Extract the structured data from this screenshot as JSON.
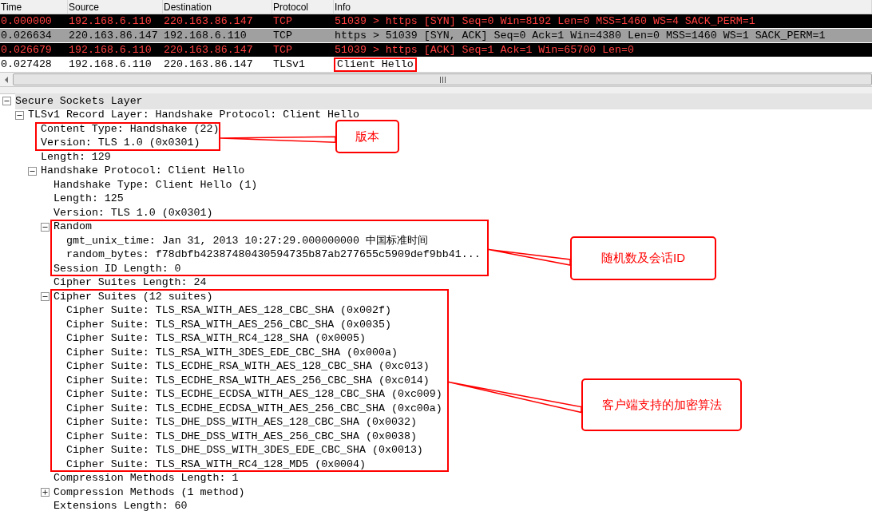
{
  "packet_list": {
    "columns": [
      "Time",
      "Source",
      "Destination",
      "Protocol",
      "Info"
    ],
    "rows": [
      {
        "kind": "dark",
        "cells": [
          "0.000000",
          "192.168.6.110",
          "220.163.86.147",
          "TCP",
          "51039 > https [SYN] Seq=0 Win=8192 Len=0 MSS=1460 WS=4 SACK_PERM=1"
        ],
        "info_boxed": false
      },
      {
        "kind": "gray",
        "cells": [
          "0.026634",
          "220.163.86.147",
          "192.168.6.110",
          "TCP",
          "https > 51039 [SYN, ACK] Seq=0 Ack=1 Win=4380 Len=0 MSS=1460 WS=1 SACK_PERM=1"
        ],
        "info_boxed": false
      },
      {
        "kind": "dark",
        "cells": [
          "0.026679",
          "192.168.6.110",
          "220.163.86.147",
          "TCP",
          "51039 > https [ACK] Seq=1 Ack=1 Win=65700 Len=0"
        ],
        "info_boxed": false
      },
      {
        "kind": "plain",
        "cells": [
          "0.027428",
          "192.168.6.110",
          "220.163.86.147",
          "TLSv1",
          "Client Hello"
        ],
        "info_boxed": true
      }
    ]
  },
  "detail_tree": [
    {
      "text": "Secure Sockets Layer",
      "expanded": true,
      "selected": true,
      "children": [
        {
          "text": "TLSv1 Record Layer: Handshake Protocol: Client Hello",
          "expanded": true,
          "selected": false,
          "children": [
            {
              "text": "Content Type: Handshake (22)",
              "selected": false
            },
            {
              "text": "Version: TLS 1.0 (0x0301)",
              "selected": false
            },
            {
              "text": "Length: 129",
              "selected": false
            },
            {
              "text": "Handshake Protocol: Client Hello",
              "expanded": true,
              "selected": false,
              "children": [
                {
                  "text": "Handshake Type: Client Hello (1)",
                  "selected": false
                },
                {
                  "text": "Length: 125",
                  "selected": false
                },
                {
                  "text": "Version: TLS 1.0 (0x0301)",
                  "selected": false
                },
                {
                  "text": "Random",
                  "expanded": true,
                  "selected": false,
                  "children": [
                    {
                      "text": "gmt_unix_time: Jan 31, 2013 10:27:29.000000000 中国标准时间",
                      "selected": false
                    },
                    {
                      "text": "random_bytes: f78dbfb42387480430594735b87ab277655c5909def9bb41...",
                      "selected": false
                    }
                  ]
                },
                {
                  "text": "Session ID Length: 0",
                  "selected": false
                },
                {
                  "text": "Cipher Suites Length: 24",
                  "selected": false
                },
                {
                  "text": "Cipher Suites (12 suites)",
                  "expanded": true,
                  "selected": false,
                  "children": [
                    {
                      "text": "Cipher Suite: TLS_RSA_WITH_AES_128_CBC_SHA (0x002f)",
                      "selected": false
                    },
                    {
                      "text": "Cipher Suite: TLS_RSA_WITH_AES_256_CBC_SHA (0x0035)",
                      "selected": false
                    },
                    {
                      "text": "Cipher Suite: TLS_RSA_WITH_RC4_128_SHA (0x0005)",
                      "selected": false
                    },
                    {
                      "text": "Cipher Suite: TLS_RSA_WITH_3DES_EDE_CBC_SHA (0x000a)",
                      "selected": false
                    },
                    {
                      "text": "Cipher Suite: TLS_ECDHE_RSA_WITH_AES_128_CBC_SHA (0xc013)",
                      "selected": false
                    },
                    {
                      "text": "Cipher Suite: TLS_ECDHE_RSA_WITH_AES_256_CBC_SHA (0xc014)",
                      "selected": false
                    },
                    {
                      "text": "Cipher Suite: TLS_ECDHE_ECDSA_WITH_AES_128_CBC_SHA (0xc009)",
                      "selected": false
                    },
                    {
                      "text": "Cipher Suite: TLS_ECDHE_ECDSA_WITH_AES_256_CBC_SHA (0xc00a)",
                      "selected": false
                    },
                    {
                      "text": "Cipher Suite: TLS_DHE_DSS_WITH_AES_128_CBC_SHA (0x0032)",
                      "selected": false
                    },
                    {
                      "text": "Cipher Suite: TLS_DHE_DSS_WITH_AES_256_CBC_SHA (0x0038)",
                      "selected": false
                    },
                    {
                      "text": "Cipher Suite: TLS_DHE_DSS_WITH_3DES_EDE_CBC_SHA (0x0013)",
                      "selected": false
                    },
                    {
                      "text": "Cipher Suite: TLS_RSA_WITH_RC4_128_MD5 (0x0004)",
                      "selected": false
                    }
                  ]
                },
                {
                  "text": "Compression Methods Length: 1",
                  "selected": false
                },
                {
                  "text": "Compression Methods (1 method)",
                  "expanded": false,
                  "selected": false
                },
                {
                  "text": "Extensions Length: 60",
                  "selected": false
                }
              ]
            }
          ]
        }
      ]
    }
  ],
  "annotations": [
    {
      "label": "版本"
    },
    {
      "label": "随机数及会话ID"
    },
    {
      "label": "客户端支持的加密算法"
    }
  ]
}
